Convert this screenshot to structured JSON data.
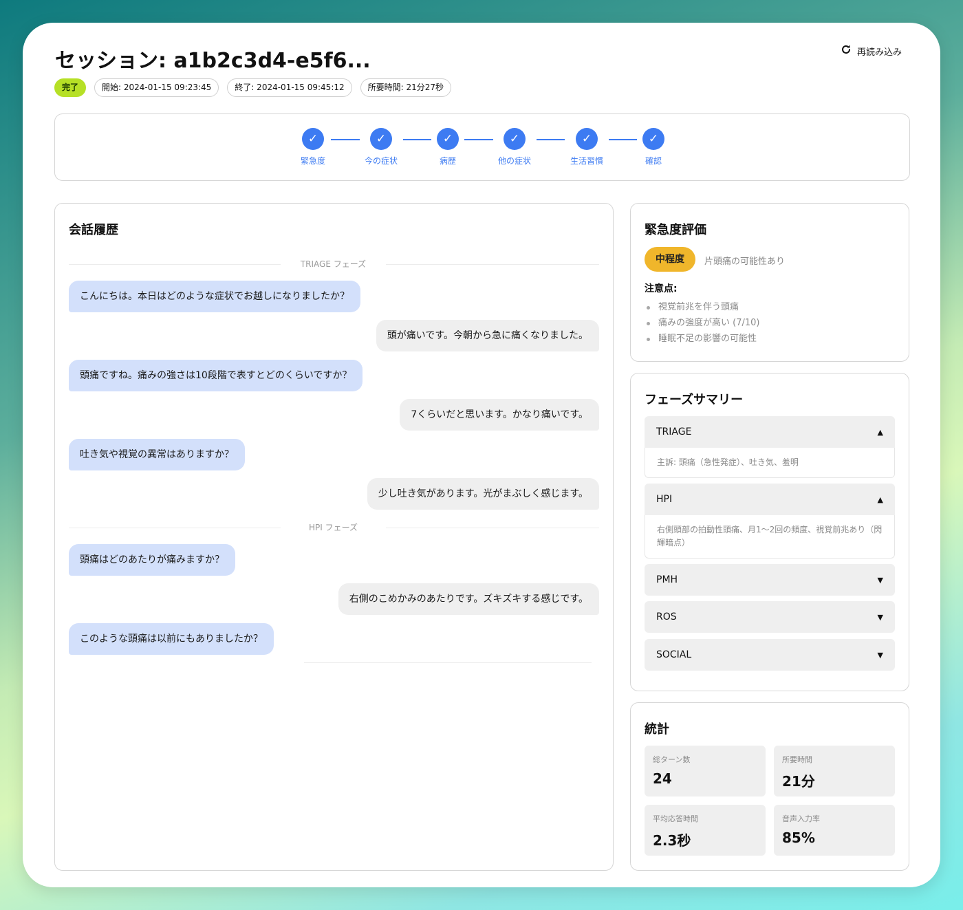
{
  "header": {
    "title": "セッション: a1b2c3d4-e5f6...",
    "reload_label": "再読み込み",
    "status": "完了",
    "start": "開始: 2024-01-15 09:23:45",
    "end": "終了: 2024-01-15 09:45:12",
    "duration": "所要時間: 21分27秒"
  },
  "steps": [
    {
      "label": "緊急度",
      "icon": "check-icon"
    },
    {
      "label": "今の症状",
      "icon": "check-icon"
    },
    {
      "label": "病歴",
      "icon": "check-icon"
    },
    {
      "label": "他の症状",
      "icon": "check-icon"
    },
    {
      "label": "生活習慣",
      "icon": "check-icon"
    },
    {
      "label": "確認",
      "icon": "check-icon"
    }
  ],
  "chat": {
    "title": "会話履歴",
    "phases": [
      "TRIAGE フェーズ",
      "HPI フェーズ"
    ],
    "messages": [
      {
        "role": "bot",
        "text": "こんにちは。本日はどのような症状でお越しになりましたか？"
      },
      {
        "role": "user",
        "text": "頭が痛いです。今朝から急に痛くなりました。"
      },
      {
        "role": "bot",
        "text": "頭痛ですね。痛みの強さは10段階で表すとどのくらいですか？"
      },
      {
        "role": "user",
        "text": "7くらいだと思います。かなり痛いです。"
      },
      {
        "role": "bot",
        "text": "吐き気や視覚の異常はありますか？"
      },
      {
        "role": "user",
        "text": "少し吐き気があります。光がまぶしく感じます。"
      },
      {
        "role": "bot",
        "text": "頭痛はどのあたりが痛みますか？"
      },
      {
        "role": "user",
        "text": "右側のこめかみのあたりです。ズキズキする感じです。"
      },
      {
        "role": "bot",
        "text": "このような頭痛は以前にもありましたか？"
      }
    ]
  },
  "urgency": {
    "title": "緊急度評価",
    "level": "中程度",
    "level_color": "#f0b62b",
    "note": "片頭痛の可能性あり",
    "points_title": "注意点:",
    "points": [
      "視覚前兆を伴う頭痛",
      "痛みの強度が高い (7/10)",
      "睡眠不足の影響の可能性"
    ]
  },
  "summary": {
    "title": "フェーズサマリー",
    "sections": [
      {
        "name": "TRIAGE",
        "open": true,
        "caret": "▲",
        "body": "主訴: 頭痛（急性発症）、吐き気、羞明"
      },
      {
        "name": "HPI",
        "open": true,
        "caret": "▲",
        "body": "右側頭部の拍動性頭痛、月1〜2回の頻度、視覚前兆あり（閃輝暗点）"
      },
      {
        "name": "PMH",
        "open": false,
        "caret": "▼"
      },
      {
        "name": "ROS",
        "open": false,
        "caret": "▼"
      },
      {
        "name": "SOCIAL",
        "open": false,
        "caret": "▼"
      }
    ]
  },
  "stats": {
    "title": "統計",
    "items": [
      {
        "label": "総ターン数",
        "value": "24"
      },
      {
        "label": "所要時間",
        "value": "21分"
      },
      {
        "label": "平均応答時間",
        "value": "2.3秒"
      },
      {
        "label": "音声入力率",
        "value": "85%"
      }
    ]
  },
  "colors": {
    "accent": "#3d7bf2",
    "bot_bubble": "#d3e0fb",
    "user_bubble": "#efefef",
    "status_done": "#b6e026"
  }
}
